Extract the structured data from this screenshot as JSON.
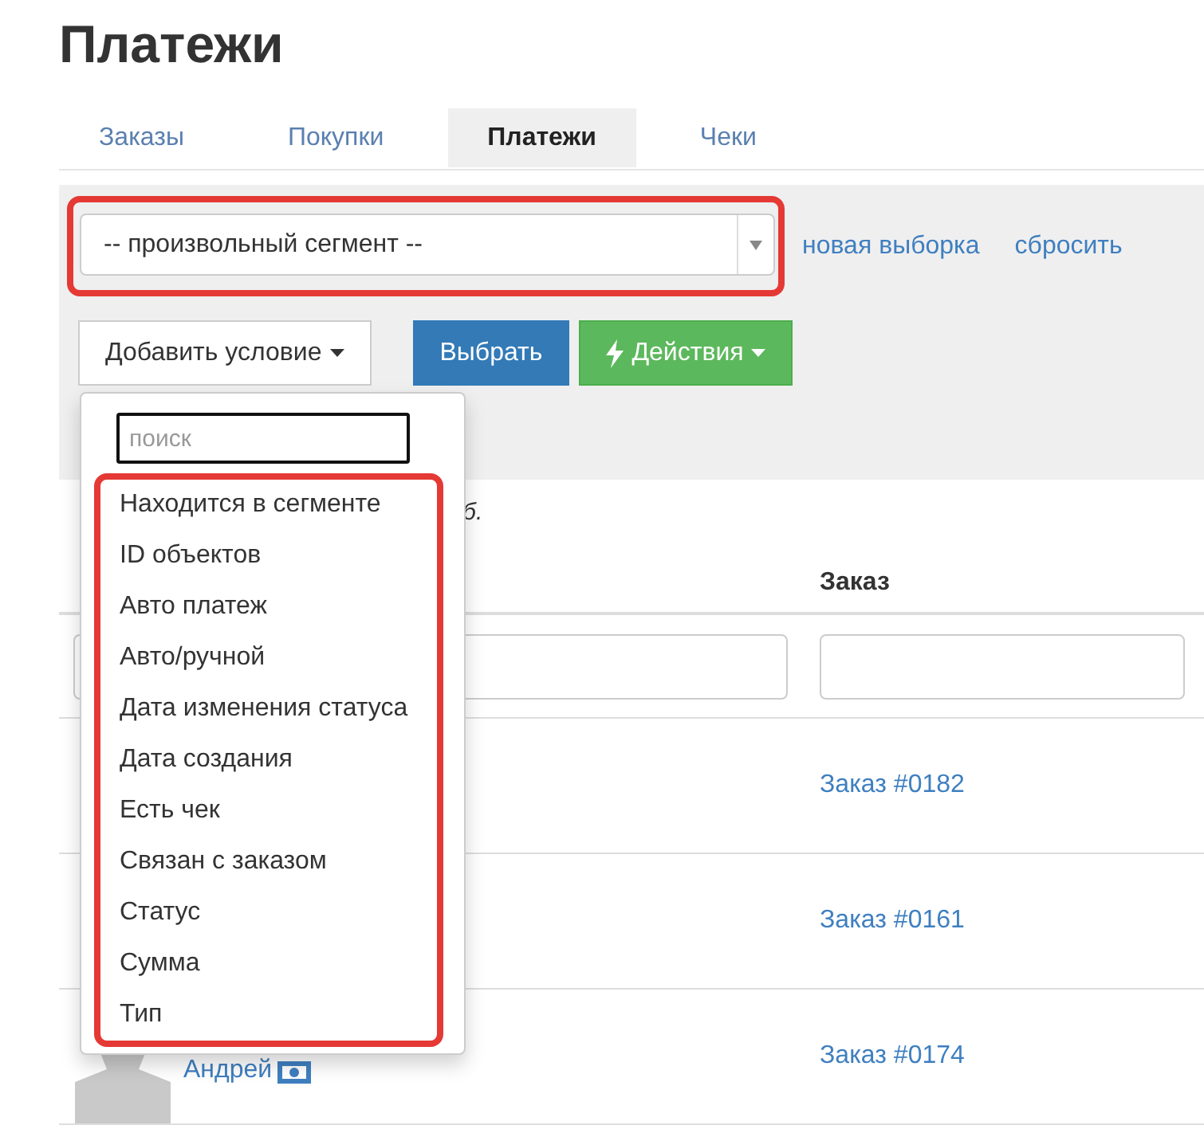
{
  "page": {
    "title": "Платежи"
  },
  "tabs": [
    {
      "label": "Заказы",
      "selected": false
    },
    {
      "label": "Покупки",
      "selected": false
    },
    {
      "label": "Платежи",
      "selected": true
    },
    {
      "label": "Чеки",
      "selected": false
    }
  ],
  "segment_select": {
    "value": "-- произвольный сегмент --",
    "highlighted": true
  },
  "links": [
    "новая выборка",
    "сбросить"
  ],
  "buttons": [
    {
      "label": "Добавить условие",
      "kind": "dropdown"
    },
    {
      "label": "Выбрать",
      "kind": "primary"
    },
    {
      "label": "Действия",
      "kind": "action"
    }
  ],
  "condition_menu": {
    "placeholder": "поиск",
    "highlighted": true,
    "items": [
      "Находится в сегменте",
      "ID объектов",
      "Авто платеж",
      "Авто/ручной",
      "Дата изменения статуса",
      "Дата создания",
      "Есть чек",
      "Связан с заказом",
      "Статус",
      "Сумма",
      "Тип"
    ]
  },
  "note_fragment": "б.",
  "table": {
    "columns": [
      "Заказ"
    ],
    "rows": [
      {
        "order": "Заказ #0182"
      },
      {
        "order": "Заказ #0161"
      },
      {
        "customer": "Андрей",
        "order": "Заказ #0174"
      }
    ]
  }
}
